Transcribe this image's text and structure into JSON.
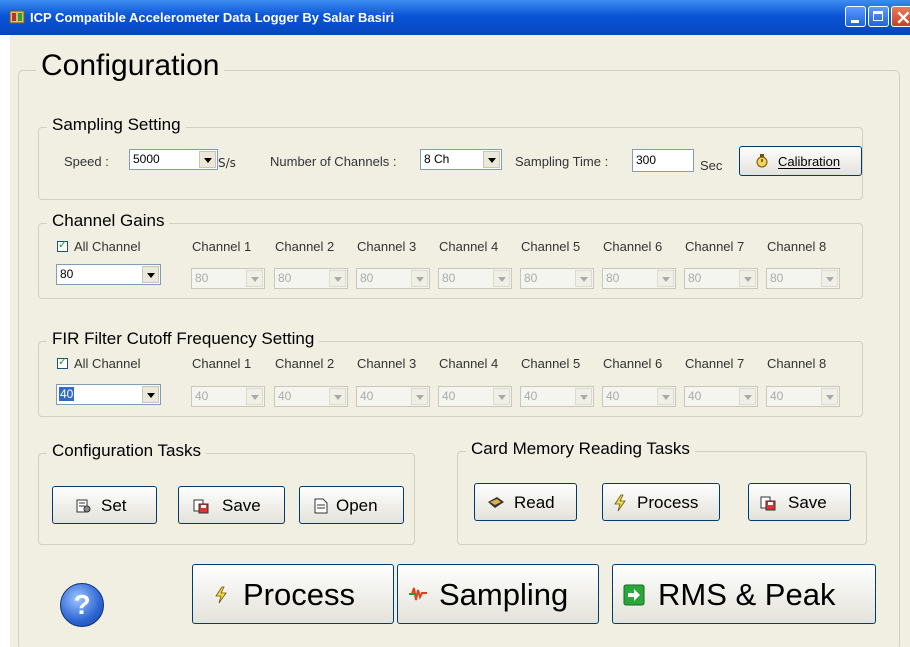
{
  "window": {
    "title": "ICP Compatible  Accelerometer Data Logger By Salar Basiri"
  },
  "configuration": {
    "label": "Configuration"
  },
  "sampling": {
    "label": "Sampling Setting",
    "speed_label": "Speed :",
    "speed_value": "5000",
    "speed_unit": "S/s",
    "channels_label": "Number of Channels :",
    "channels_value": "8 Ch",
    "time_label": "Sampling Time :",
    "time_value": "300",
    "time_unit": "Sec",
    "calibration_label": "Calibration"
  },
  "gains": {
    "label": "Channel Gains",
    "all_channel_label": "All Channel",
    "all_value": "80",
    "channels": [
      {
        "label": "Channel 1",
        "value": "80"
      },
      {
        "label": "Channel 2",
        "value": "80"
      },
      {
        "label": "Channel 3",
        "value": "80"
      },
      {
        "label": "Channel 4",
        "value": "80"
      },
      {
        "label": "Channel 5",
        "value": "80"
      },
      {
        "label": "Channel 6",
        "value": "80"
      },
      {
        "label": "Channel 7",
        "value": "80"
      },
      {
        "label": "Channel 8",
        "value": "80"
      }
    ]
  },
  "fir": {
    "label": "FIR Filter Cutoff Frequency Setting",
    "all_channel_label": "All Channel",
    "all_value": "40",
    "channels": [
      {
        "label": "Channel 1",
        "value": "40"
      },
      {
        "label": "Channel 2",
        "value": "40"
      },
      {
        "label": "Channel 3",
        "value": "40"
      },
      {
        "label": "Channel 4",
        "value": "40"
      },
      {
        "label": "Channel 5",
        "value": "40"
      },
      {
        "label": "Channel 6",
        "value": "40"
      },
      {
        "label": "Channel 7",
        "value": "40"
      },
      {
        "label": "Channel 8",
        "value": "40"
      }
    ]
  },
  "config_tasks": {
    "label": "Configuration Tasks",
    "set_label": "Set",
    "save_label": "Save",
    "open_label": "Open"
  },
  "card_tasks": {
    "label": "Card Memory Reading Tasks",
    "read_label": "Read",
    "process_label": "Process",
    "save_label": "Save"
  },
  "bottom": {
    "help_label": "?",
    "process_label": "Process",
    "sampling_label": "Sampling",
    "rms_label": "RMS & Peak"
  },
  "colors": {
    "titlebar": "#0a55d6",
    "window_bg": "#f1efe2",
    "selection": "#316ac5"
  }
}
